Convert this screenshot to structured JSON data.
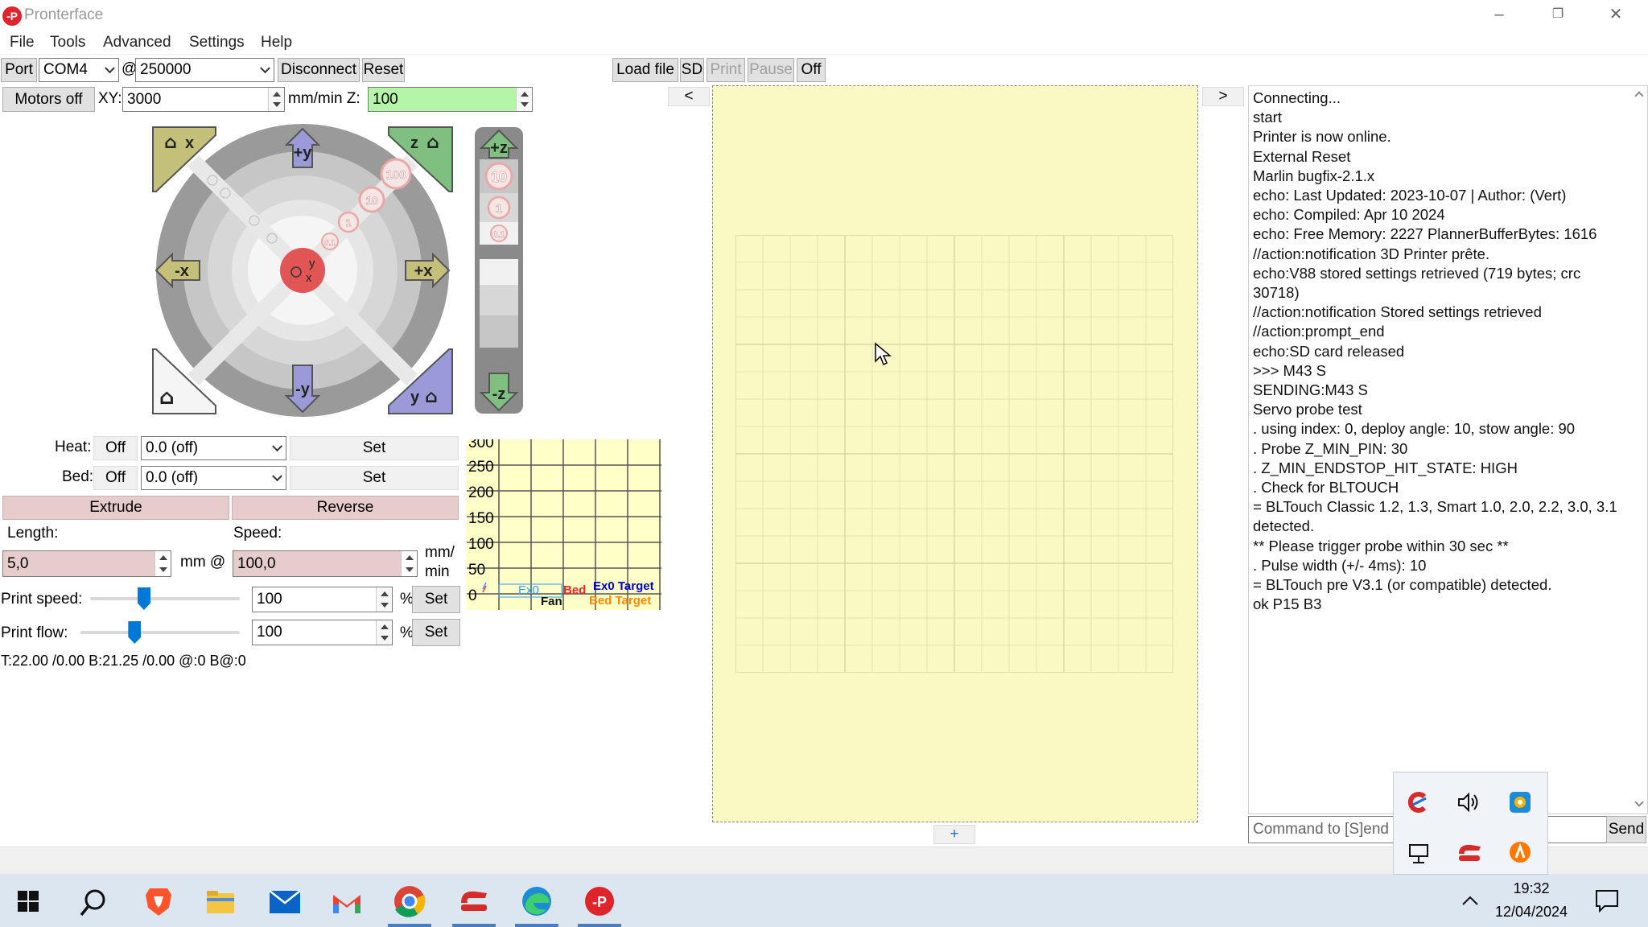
{
  "window": {
    "title": "Pronterface",
    "icon_text": "-P"
  },
  "menu": {
    "items": [
      "File",
      "Tools",
      "Advanced",
      "Settings",
      "Help"
    ]
  },
  "connection": {
    "port_label": "Port",
    "port_value": "COM4",
    "at_label": "@",
    "baud_value": "250000",
    "disconnect_label": "Disconnect",
    "reset_label": "Reset"
  },
  "print_controls": {
    "load_file_label": "Load file",
    "sd_label": "SD",
    "print_label": "Print",
    "pause_label": "Pause",
    "off_label": "Off"
  },
  "motion": {
    "motors_off_label": "Motors off",
    "xy_label": "XY:",
    "xy_value": "3000",
    "xy_unit_label": "mm/min Z:",
    "z_value": "100"
  },
  "jog": {
    "home_x": "x",
    "home_z": "z",
    "home_y": "y",
    "plus_y": "+y",
    "minus_y": "-y",
    "plus_x": "+x",
    "minus_x": "-x",
    "step_100": "100",
    "step_10": "10",
    "step_1": "1",
    "step_01": "0.1",
    "center_y": "y",
    "center_x": "x",
    "z_plus": "+z",
    "z_minus": "-z",
    "z_10": "10",
    "z_1": "1",
    "z_01": "0.1"
  },
  "temps": {
    "heat_label": "Heat:",
    "heat_off_label": "Off",
    "heat_value": "0.0 (off)",
    "heat_set_label": "Set",
    "bed_label": "Bed:",
    "bed_off_label": "Off",
    "bed_value": "0.0 (off)",
    "bed_set_label": "Set"
  },
  "extrude": {
    "extrude_label": "Extrude",
    "reverse_label": "Reverse",
    "length_label": "Length:",
    "speed_label": "Speed:",
    "length_value": "5,0",
    "mm_at_label": "mm @",
    "speed_value": "100,0",
    "unit_line1": "mm/",
    "unit_line2": "min"
  },
  "speed_flow": {
    "print_speed_label": "Print speed:",
    "print_speed_value": "100",
    "print_speed_slider": 0.36,
    "print_flow_label": "Print flow:",
    "print_flow_value": "100",
    "print_flow_slider": 0.34,
    "percent_label": "%",
    "set_label": "Set"
  },
  "status_temps": "T:22.00 /0.00 B:21.25 /0.00 @:0 B@:0",
  "graph": {
    "y_ticks": [
      "300",
      "250",
      "200",
      "150",
      "100",
      "50",
      "0"
    ],
    "legend_ex0": "Ex0",
    "legend_bed": "Bed",
    "legend_ex0_target": "Ex0 Target",
    "legend_fan": "Fan",
    "legend_bed_target": "Bed Target"
  },
  "plater": {
    "left_arrow": "<",
    "right_arrow": ">",
    "plus_label": "+"
  },
  "console": {
    "lines": [
      "Connecting...",
      "start",
      "Printer is now online.",
      " External Reset",
      "Marlin bugfix-2.1.x",
      "echo: Last Updated: 2023-10-07 | Author: (Vert)",
      "echo: Compiled: Apr 10 2024",
      "echo: Free Memory: 2227  PlannerBufferBytes: 1616",
      "//action:notification 3D Printer prête.",
      "echo:V88 stored settings retrieved (719 bytes; crc",
      "30718)",
      "//action:notification Stored settings retrieved",
      "//action:prompt_end",
      "echo:SD card released",
      ">>> M43 S",
      "SENDING:M43 S",
      "Servo probe test",
      ". using index:  0, deploy angle: 10, stow angle:   90",
      ". Probe Z_MIN_PIN: 30",
      ". Z_MIN_ENDSTOP_HIT_STATE: HIGH",
      ". Check for BLTOUCH",
      "= BLTouch Classic 1.2, 1.3, Smart 1.0, 2.0, 2.2, 3.0, 3.1",
      "detected.",
      "** Please trigger probe within 30 sec **",
      ". Pulse width (+/- 4ms): 10",
      "= BLTouch pre V3.1 (or compatible) detected.",
      "ok P15 B3"
    ],
    "command_placeholder": "Command to [S]end",
    "send_label": "Send"
  },
  "taskbar": {
    "time": "19:32",
    "date": "12/04/2024",
    "icons": [
      "start-icon",
      "search-icon",
      "brave-icon",
      "file-explorer-icon",
      "mail-icon",
      "gmail-icon",
      "chrome-icon",
      "pronterface-red-icon",
      "edge-icon",
      "pronterface-icon"
    ]
  },
  "colors": {
    "z_field_bg": "#b5f5a8",
    "extrude_bg": "#e7cccc",
    "plater_bg": "#f9f9c3",
    "graph_bg": "#ffffc8",
    "taskbar_bg": "#dce6f1"
  }
}
